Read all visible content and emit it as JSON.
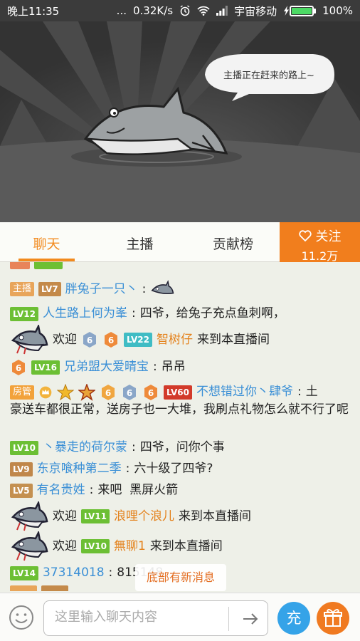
{
  "status_bar": {
    "time": "晚上11:35",
    "dots": "...",
    "speed": "0.32K/s",
    "carrier": "宇宙移动",
    "battery": "100%"
  },
  "video": {
    "speech_bubble": "主播正在赶来的路上~"
  },
  "tabs": [
    {
      "label": "聊天",
      "active": true
    },
    {
      "label": "主播",
      "active": false
    },
    {
      "label": "贡献榜",
      "active": false
    }
  ],
  "follow": {
    "label": "关注",
    "count": "11.2万"
  },
  "chat": {
    "messages": [
      {
        "badges": [
          "主播",
          "LV7"
        ],
        "user": "胖兔子一只丶",
        "sep": ":"
      },
      {
        "badges": [
          "LV12"
        ],
        "user": "人生路上何为峯",
        "sep": ":",
        "text": "四爷，给兔子充点鱼刺啊，"
      },
      {
        "welcome": "欢迎",
        "badges": [
          "LV22"
        ],
        "user": "智树仔",
        "text": "来到本直播间"
      },
      {
        "badges": [
          "LV16"
        ],
        "user": "兄弟盟大爱晴宝",
        "sep": ":",
        "text": "吊吊"
      },
      {
        "badges": [
          "房管",
          "LV60"
        ],
        "user": "不想错过你丶肆爷",
        "sep": ":",
        "text_start": "土",
        "text_rest": "豪送车都很正常，送房子也一大堆，我刷点礼物怎么就不行了呢"
      },
      {
        "badges": [
          "LV10"
        ],
        "user": "丶暴走的荷尔蒙",
        "sep": ":",
        "text": "四爷，问你个事"
      },
      {
        "badges": [
          "LV9"
        ],
        "user": "东京喰种第二季",
        "sep": ":",
        "text": "六十级了四爷?"
      },
      {
        "badges": [
          "LV5"
        ],
        "user": "有名贵姓",
        "sep": ":",
        "text": "来吧  黑屏火箭"
      },
      {
        "welcome": "欢迎",
        "badges": [
          "LV11"
        ],
        "user": "浪哩个浪儿",
        "text": "来到本直播间"
      },
      {
        "welcome": "欢迎",
        "badges": [
          "LV10"
        ],
        "user": "無聊1",
        "text": "来到本直播间"
      },
      {
        "badges": [
          "LV14"
        ],
        "user": "37314018",
        "sep": ":",
        "text": "815148"
      }
    ],
    "medal_6": "6"
  },
  "toast": "底部有新消息",
  "input": {
    "placeholder": "这里输入聊天内容",
    "charge_label": "充"
  },
  "colors": {
    "accent": "#f17e1d",
    "charge": "#35a3e8",
    "name_blue": "#3a8fd6",
    "name_orange": "#e4821c"
  }
}
